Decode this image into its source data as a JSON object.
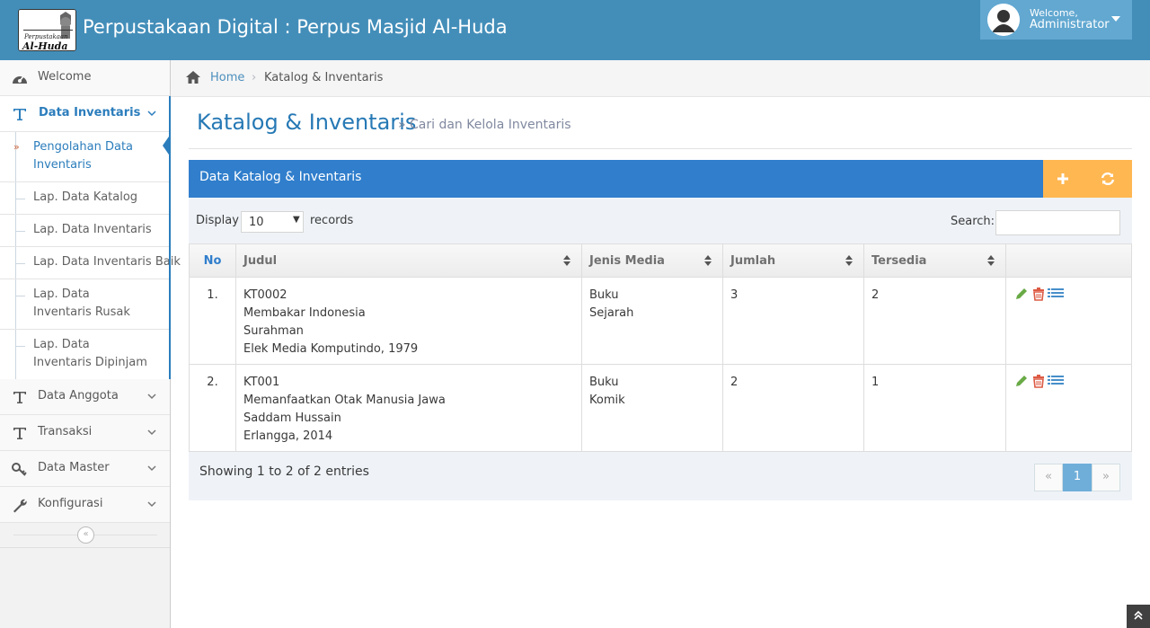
{
  "header": {
    "logo_text_top": "Perpustakaan",
    "logo_text_main": "Al-Huda",
    "brand": "Perpustakaan Digital : Perpus Masjid Al-Huda",
    "user_welcome": "Welcome,",
    "user_name": "Administrator"
  },
  "sidebar": {
    "items": [
      {
        "label": "Welcome",
        "icon": "dashboard-icon"
      },
      {
        "label": "Data Inventaris",
        "icon": "text-t-icon"
      },
      {
        "label": "Data Anggota",
        "icon": "text-t-icon"
      },
      {
        "label": "Transaksi",
        "icon": "text-t-icon"
      },
      {
        "label": "Data Master",
        "icon": "key-icon"
      },
      {
        "label": "Konfigurasi",
        "icon": "wrench-icon"
      }
    ],
    "submenu": [
      {
        "label": "Pengolahan Data Inventaris"
      },
      {
        "label": "Lap. Data Katalog"
      },
      {
        "label": "Lap. Data Inventaris"
      },
      {
        "label": "Lap. Data Inventaris Baik"
      },
      {
        "label": "Lap. Data Inventaris Rusak"
      },
      {
        "label": "Lap. Data Inventaris Dipinjam"
      }
    ],
    "collapse_glyph": "«"
  },
  "breadcrumb": {
    "home": "Home",
    "separator": "›",
    "current": "Katalog & Inventaris"
  },
  "page": {
    "title": "Katalog & Inventaris",
    "subtitle": "» Cari dan Kelola Inventaris"
  },
  "widget": {
    "title": "Data Katalog & Inventaris",
    "tools": [
      "plus-icon",
      "refresh-icon"
    ]
  },
  "table_controls": {
    "display_label": "Display",
    "display_value": "10",
    "records_label": "records",
    "search_label": "Search:"
  },
  "table": {
    "columns": [
      "No",
      "Judul",
      "Jenis Media",
      "Jumlah",
      "Tersedia"
    ],
    "rows": [
      {
        "no": "1.",
        "judul": [
          "KT0002",
          "Membakar Indonesia",
          "Surahman",
          "Elek Media Komputindo, 1979"
        ],
        "jenis": [
          "Buku",
          "Sejarah"
        ],
        "jumlah": "3",
        "tersedia": "2"
      },
      {
        "no": "2.",
        "judul": [
          "KT001",
          "Memanfaatkan Otak Manusia Jawa",
          "Saddam Hussain",
          "Erlangga, 2014"
        ],
        "jenis": [
          "Buku",
          "Komik"
        ],
        "jumlah": "2",
        "tersedia": "1"
      }
    ]
  },
  "footer": {
    "info": "Showing 1 to 2 of 2 entries",
    "pagination": {
      "prev": "«",
      "current": "1",
      "next": "»"
    }
  },
  "colors": {
    "navbar": "#438eb9",
    "accent": "#2b7dbc",
    "widget_header": "#307ecc",
    "widget_tools": "#ffb752",
    "edit_icon": "#69aa46",
    "delete_icon": "#dd5a43",
    "list_icon": "#478fca"
  }
}
